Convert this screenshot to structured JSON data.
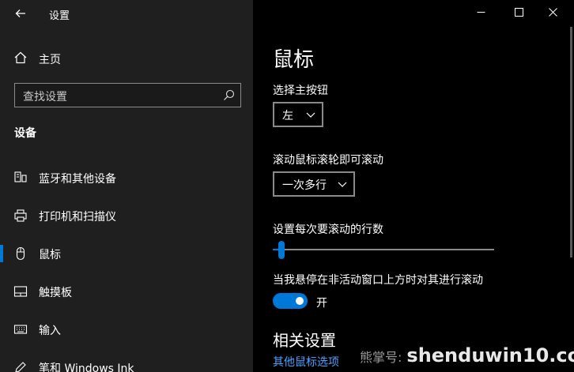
{
  "window": {
    "title": "设置",
    "controls": {
      "minimize": "—",
      "maximize": "☐",
      "close": "✕"
    }
  },
  "nav": {
    "home_label": "主页",
    "search_placeholder": "查找设置",
    "section_title": "设备",
    "items": [
      {
        "label": "蓝牙和其他设备",
        "icon": "bluetooth-devices-icon"
      },
      {
        "label": "打印机和扫描仪",
        "icon": "printer-icon"
      },
      {
        "label": "鼠标",
        "icon": "mouse-icon",
        "selected": true
      },
      {
        "label": "触摸板",
        "icon": "touchpad-icon"
      },
      {
        "label": "输入",
        "icon": "keyboard-icon"
      },
      {
        "label": "笔和 Windows Ink",
        "icon": "pen-icon"
      }
    ]
  },
  "main": {
    "title": "鼠标",
    "primary_button": {
      "label": "选择主按钮",
      "value": "左"
    },
    "scroll_mode": {
      "label": "滚动鼠标滚轮即可滚动",
      "value": "一次多行"
    },
    "lines_to_scroll": {
      "label": "设置每次要滚动的行数",
      "value_fraction": 0.03
    },
    "inactive_scroll": {
      "label": "当我悬停在非活动窗口上方时对其进行滚动",
      "state": "开",
      "on": true
    },
    "related": {
      "title": "相关设置",
      "link": "其他鼠标选项"
    }
  },
  "watermark": {
    "prefix": "熊掌号:",
    "site": "shenduwin10.com"
  },
  "colors": {
    "accent": "#0078d7",
    "left_bg": "#1f1f1f",
    "right_bg": "#000000",
    "link": "#4aa0ff"
  }
}
